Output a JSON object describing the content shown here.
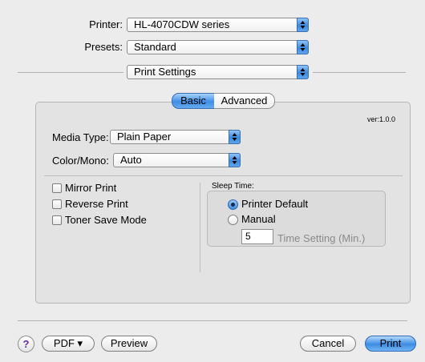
{
  "printer": {
    "label": "Printer:",
    "value": "HL-4070CDW series"
  },
  "presets": {
    "label": "Presets:",
    "value": "Standard"
  },
  "panel": {
    "value": "Print Settings"
  },
  "tabs": [
    {
      "label": "Basic"
    },
    {
      "label": "Advanced"
    }
  ],
  "version": "ver:1.0.0",
  "media_type": {
    "label": "Media Type:",
    "value": "Plain Paper"
  },
  "color_mono": {
    "label": "Color/Mono:",
    "value": "Auto"
  },
  "options": [
    {
      "label": "Mirror Print",
      "checked": false
    },
    {
      "label": "Reverse Print",
      "checked": false
    },
    {
      "label": "Toner Save Mode",
      "checked": false
    }
  ],
  "sleep": {
    "title": "Sleep Time:",
    "printer_default": "Printer Default",
    "manual": "Manual",
    "selected": "Printer Default",
    "time_value": "5",
    "time_label": "Time Setting (Min.)"
  },
  "footer": {
    "help": "?",
    "pdf": "PDF ▾",
    "preview": "Preview",
    "cancel": "Cancel",
    "print": "Print"
  }
}
